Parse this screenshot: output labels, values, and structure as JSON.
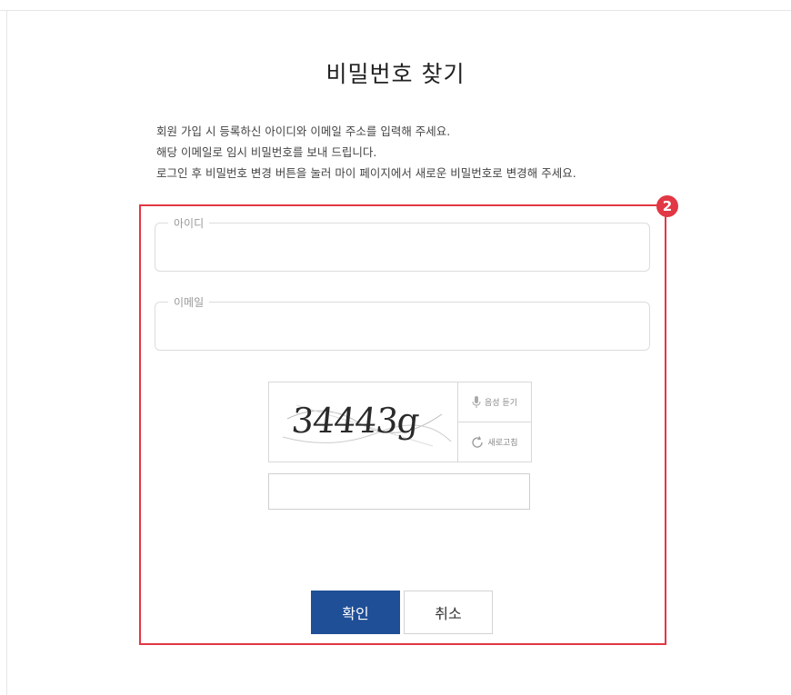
{
  "page": {
    "title": "비밀번호 찾기",
    "description": [
      "회원 가입 시 등록하신 아이디와 이메일 주소를 입력해 주세요.",
      "해당 이메일로 임시 비밀번호를 보내 드립니다.",
      "로그인 후 비밀번호 변경 버튼을 눌러 마이 페이지에서 새로운 비밀번호로 변경해 주세요."
    ]
  },
  "annotation": {
    "badge": "2",
    "color": "#e23744"
  },
  "form": {
    "id_label": "아이디",
    "id_value": "",
    "email_label": "이메일",
    "email_value": ""
  },
  "captcha": {
    "code": "34443g",
    "audio_label": "음성 듣기",
    "refresh_label": "새로고침",
    "input_value": ""
  },
  "buttons": {
    "confirm": "확인",
    "cancel": "취소",
    "confirm_color": "#1f4f96"
  }
}
